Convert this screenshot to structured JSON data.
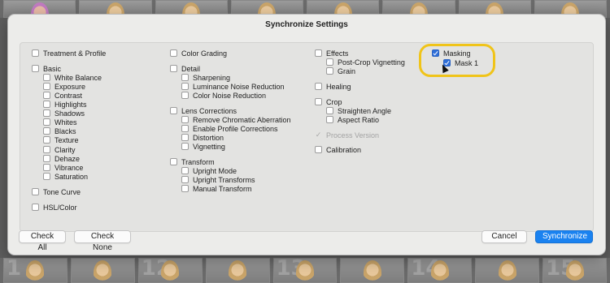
{
  "dialog": {
    "title": "Synchronize Settings"
  },
  "col1": {
    "treatment": {
      "label": "Treatment & Profile",
      "checked": false
    },
    "basic": {
      "label": "Basic",
      "checked": false,
      "items": [
        {
          "label": "White Balance",
          "checked": false
        },
        {
          "label": "Exposure",
          "checked": false
        },
        {
          "label": "Contrast",
          "checked": false
        },
        {
          "label": "Highlights",
          "checked": false
        },
        {
          "label": "Shadows",
          "checked": false
        },
        {
          "label": "Whites",
          "checked": false
        },
        {
          "label": "Blacks",
          "checked": false
        },
        {
          "label": "Texture",
          "checked": false
        },
        {
          "label": "Clarity",
          "checked": false
        },
        {
          "label": "Dehaze",
          "checked": false
        },
        {
          "label": "Vibrance",
          "checked": false
        },
        {
          "label": "Saturation",
          "checked": false
        }
      ]
    },
    "tone_curve": {
      "label": "Tone Curve",
      "checked": false
    },
    "hsl": {
      "label": "HSL/Color",
      "checked": false
    }
  },
  "col2": {
    "color_grading": {
      "label": "Color Grading",
      "checked": false
    },
    "detail": {
      "label": "Detail",
      "checked": false,
      "items": [
        {
          "label": "Sharpening",
          "checked": false
        },
        {
          "label": "Luminance Noise Reduction",
          "checked": false
        },
        {
          "label": "Color Noise Reduction",
          "checked": false
        }
      ]
    },
    "lens": {
      "label": "Lens Corrections",
      "checked": false,
      "items": [
        {
          "label": "Remove Chromatic Aberration",
          "checked": false
        },
        {
          "label": "Enable Profile Corrections",
          "checked": false
        },
        {
          "label": "Distortion",
          "checked": false
        },
        {
          "label": "Vignetting",
          "checked": false
        }
      ]
    },
    "transform": {
      "label": "Transform",
      "checked": false,
      "items": [
        {
          "label": "Upright Mode",
          "checked": false
        },
        {
          "label": "Upright Transforms",
          "checked": false
        },
        {
          "label": "Manual Transform",
          "checked": false
        }
      ]
    }
  },
  "col3": {
    "effects": {
      "label": "Effects",
      "checked": false,
      "items": [
        {
          "label": "Post-Crop Vignetting",
          "checked": false
        },
        {
          "label": "Grain",
          "checked": false
        }
      ]
    },
    "healing": {
      "label": "Healing",
      "checked": false
    },
    "crop": {
      "label": "Crop",
      "checked": false,
      "items": [
        {
          "label": "Straighten Angle",
          "checked": false
        },
        {
          "label": "Aspect Ratio",
          "checked": false
        }
      ]
    },
    "process_version": {
      "label": "Process Version",
      "checked": true,
      "disabled": true
    },
    "calibration": {
      "label": "Calibration",
      "checked": false
    }
  },
  "col4": {
    "masking": {
      "label": "Masking",
      "checked": true,
      "items": [
        {
          "label": "Mask 1",
          "checked": true
        }
      ]
    }
  },
  "buttons": {
    "check_all": "Check All",
    "check_none": "Check None",
    "cancel": "Cancel",
    "synchronize": "Synchronize"
  },
  "filmstrip": {
    "bottom_numbers": [
      "1",
      "",
      "12",
      "",
      "13",
      "",
      "14",
      "",
      "15"
    ]
  },
  "colors": {
    "accent": "#1a82f0",
    "checkbox_on": "#2f6fd9",
    "highlight": "#f0c419"
  }
}
